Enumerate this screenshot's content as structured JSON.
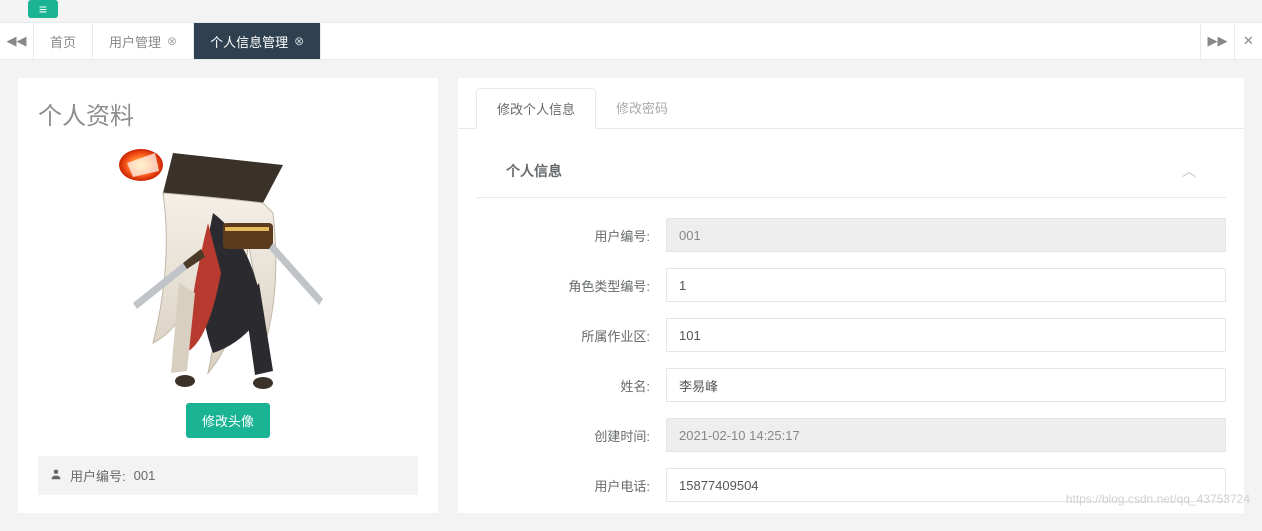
{
  "tabs": {
    "home": "首页",
    "user_mgmt": "用户管理",
    "personal_info_mgmt": "个人信息管理"
  },
  "left": {
    "title": "个人资料",
    "change_avatar_btn": "修改头像",
    "user_id_label": "用户编号:",
    "user_id_value": "001"
  },
  "inner_tabs": {
    "edit_personal": "修改个人信息",
    "change_password": "修改密码"
  },
  "section": {
    "title": "个人信息"
  },
  "form": {
    "user_id": {
      "label": "用户编号:",
      "value": "001",
      "readonly": true
    },
    "role_type_id": {
      "label": "角色类型编号:",
      "value": "1",
      "readonly": false
    },
    "work_area": {
      "label": "所属作业区:",
      "value": "101",
      "readonly": false
    },
    "name": {
      "label": "姓名:",
      "value": "李易峰",
      "readonly": false
    },
    "created_at": {
      "label": "创建时间:",
      "value": "2021-02-10 14:25:17",
      "readonly": true
    },
    "phone": {
      "label": "用户电话:",
      "value": "15877409504",
      "readonly": false
    }
  },
  "watermark": "https://blog.csdn.net/qq_43753724"
}
